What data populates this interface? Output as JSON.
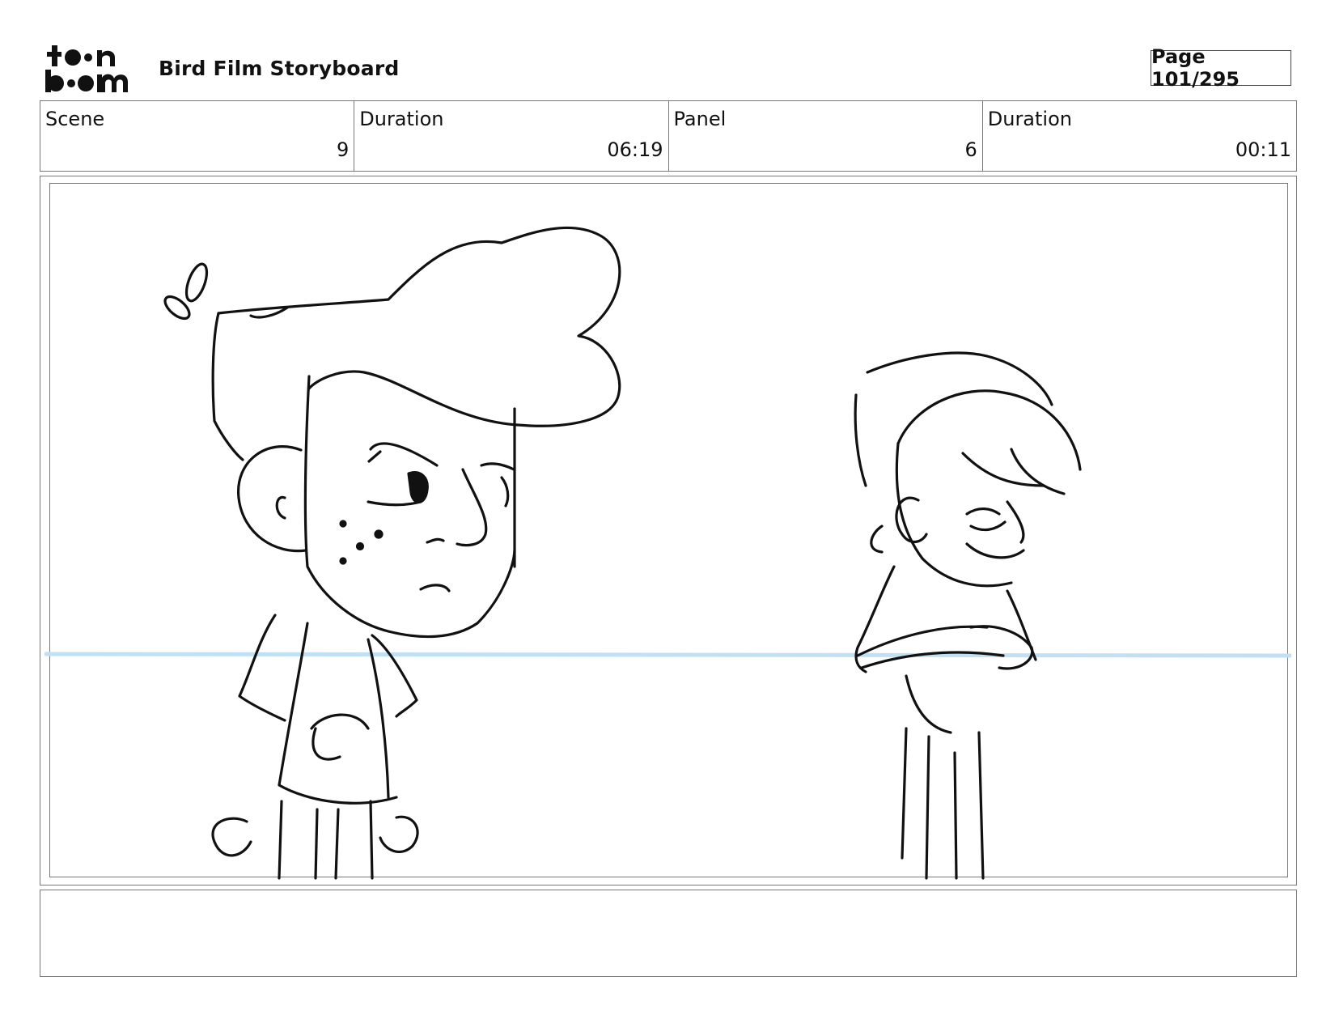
{
  "header": {
    "logo_text": "toon boom",
    "project_title": "Bird Film Storyboard",
    "page_label": "Page 101/295"
  },
  "info": {
    "scene_label": "Scene",
    "scene_value": "9",
    "scene_duration_label": "Duration",
    "scene_duration_value": "06:19",
    "panel_label": "Panel",
    "panel_value": "6",
    "panel_duration_label": "Duration",
    "panel_duration_value": "00:11"
  },
  "panel": {
    "guide_color": "#bfe0f5",
    "line_color": "#111111"
  },
  "notes": {
    "text": ""
  }
}
